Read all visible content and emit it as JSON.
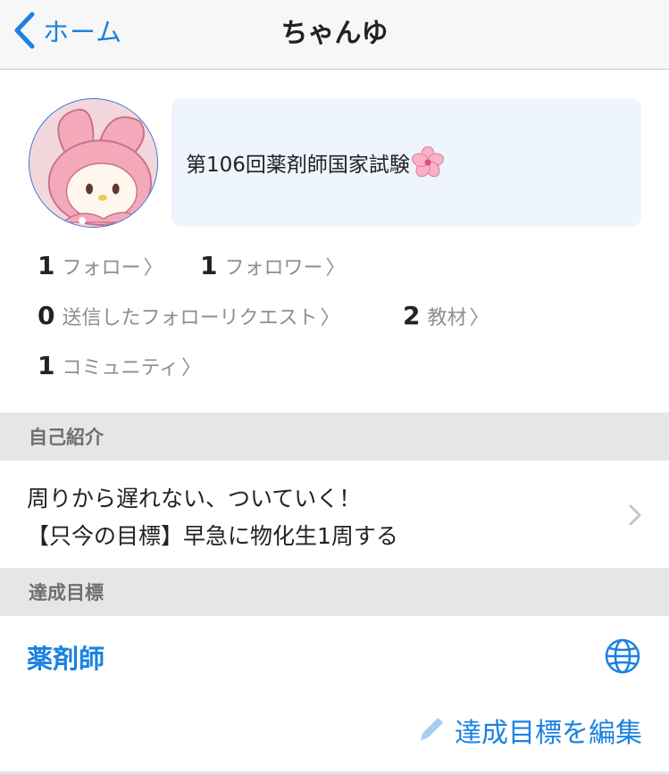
{
  "nav": {
    "back_label": "ホーム",
    "title": "ちゃんゆ"
  },
  "profile": {
    "bio": "第106回薬剤師国家試験",
    "bio_emoji": "sakura-icon"
  },
  "stats": {
    "follow": {
      "count": "1",
      "label": "フォロー",
      "chevron": "〉"
    },
    "follower": {
      "count": "1",
      "label": "フォロワー",
      "chevron": "〉"
    },
    "requests": {
      "count": "0",
      "label": "送信したフォローリクエスト",
      "chevron": "〉"
    },
    "materials": {
      "count": "2",
      "label": "教材",
      "chevron": "〉"
    },
    "community": {
      "count": "1",
      "label": "コミュニティ",
      "chevron": "〉"
    }
  },
  "sections": {
    "intro_header": "自己紹介",
    "intro_line1": "周りから遅れない、ついていく！",
    "intro_line2": "【只今の目標】早急に物化生1周する",
    "goal_header": "達成目標",
    "goal_title": "薬剤師",
    "edit_goal_label": "達成目標を編集"
  },
  "colors": {
    "accent": "#1a82e2",
    "bio_bg": "#eef5fc",
    "section_bg": "#e6e6e6"
  }
}
